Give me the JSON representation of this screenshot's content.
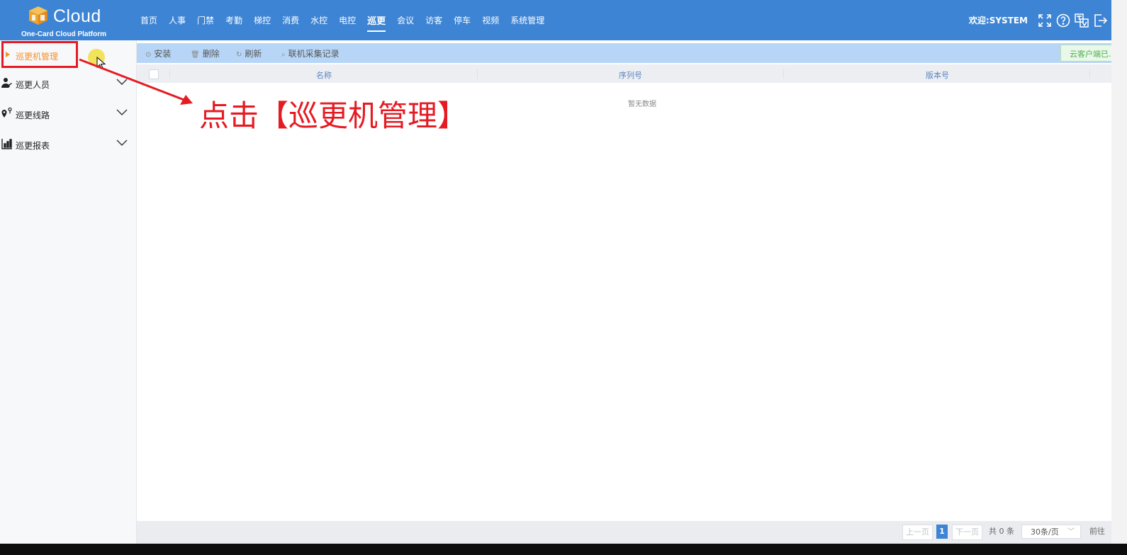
{
  "header": {
    "logo_word": "Cloud",
    "logo_sub": "One-Card Cloud Platform",
    "nav": [
      {
        "label": "首页"
      },
      {
        "label": "人事"
      },
      {
        "label": "门禁"
      },
      {
        "label": "考勤"
      },
      {
        "label": "梯控"
      },
      {
        "label": "消费"
      },
      {
        "label": "水控"
      },
      {
        "label": "电控"
      },
      {
        "label": "巡更",
        "active": true
      },
      {
        "label": "会议"
      },
      {
        "label": "访客"
      },
      {
        "label": "停车"
      },
      {
        "label": "视频"
      },
      {
        "label": "系统管理"
      }
    ],
    "welcome": "欢迎:SYSTEM",
    "icons": [
      "fullscreen-icon",
      "help-icon",
      "language-icon",
      "logout-icon"
    ]
  },
  "sidebar": {
    "active_item": "巡更机管理",
    "items": [
      {
        "label": "巡更人员",
        "icon": "person-icon"
      },
      {
        "label": "巡更线路",
        "icon": "route-pin-icon"
      },
      {
        "label": "巡更报表",
        "icon": "bar-report-icon"
      }
    ]
  },
  "toolbar": {
    "buttons": [
      {
        "label": "安装",
        "icon": "install-icon"
      },
      {
        "label": "删除",
        "icon": "trash-icon"
      },
      {
        "label": "刷新",
        "icon": "refresh-icon"
      },
      {
        "label": "联机采集记录",
        "icon": "search-icon"
      }
    ],
    "notice": "云客户端已..."
  },
  "table": {
    "columns": [
      "名称",
      "序列号",
      "版本号"
    ],
    "empty_text": "暂无数据"
  },
  "pagination": {
    "prev": "上一页",
    "page": "1",
    "next": "下一页",
    "total": "共 0 条",
    "page_size": "30条/页",
    "goto": "前往"
  },
  "annotation": {
    "callout": "点击【巡更机管理】",
    "color": "#e51b23"
  },
  "colors": {
    "header_bg": "#3d84d4",
    "toolbar_bg": "#b7d6f7",
    "active_orange": "#f5902a"
  }
}
